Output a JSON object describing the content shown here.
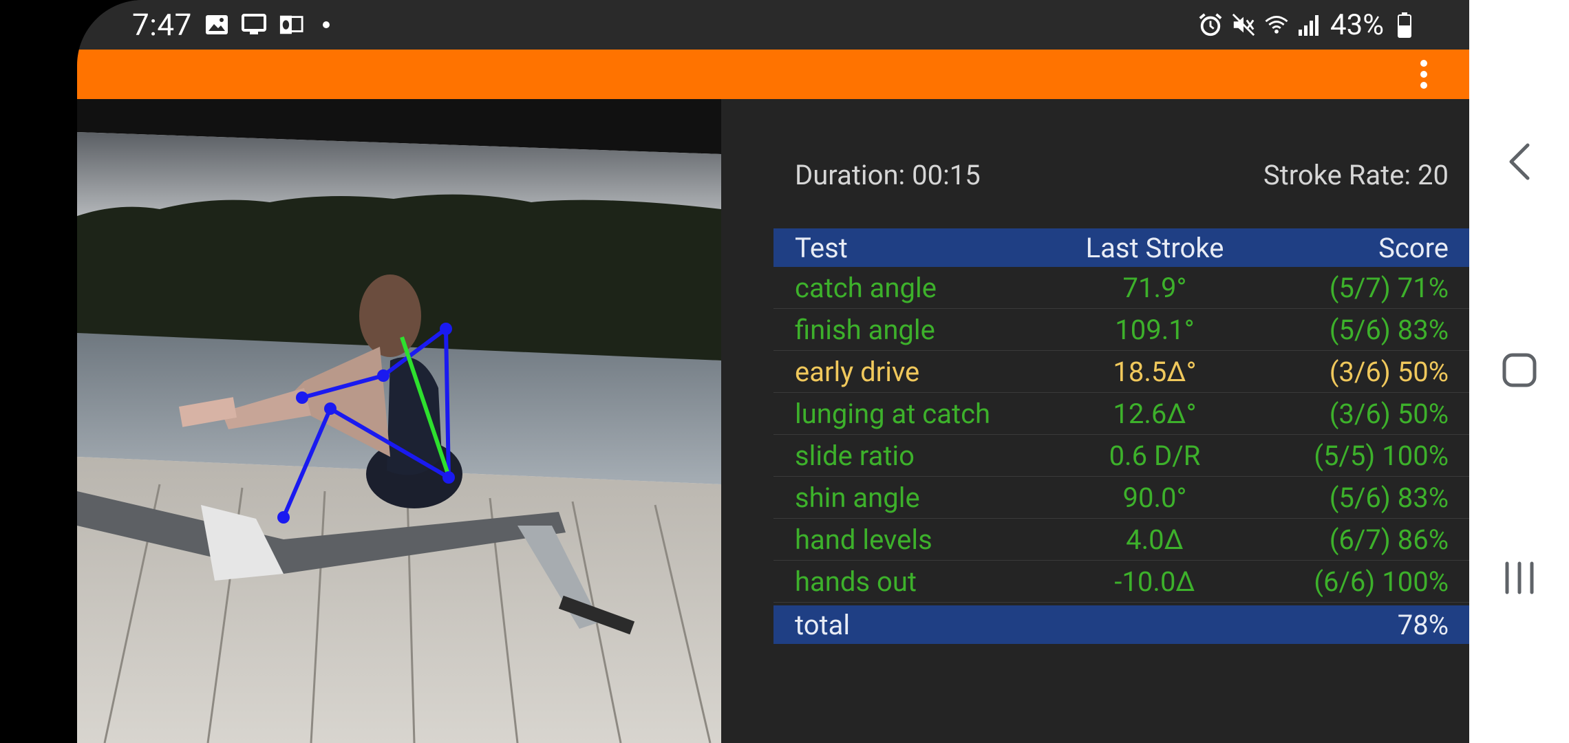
{
  "status_bar": {
    "time": "7:47",
    "battery": "43%",
    "left_icons": [
      "gallery-icon",
      "cast-icon",
      "outlook-icon",
      "notification-dot-icon"
    ],
    "right_icons": [
      "alarm-icon",
      "mute-icon",
      "wifi-icon",
      "signal-icon",
      "battery-icon"
    ]
  },
  "action_bar": {
    "color": "#ff7300",
    "menu_icon": "overflow-menu-icon"
  },
  "summary": {
    "duration": "Duration: 00:15",
    "stroke_rate": "Stroke Rate: 20"
  },
  "table": {
    "headers": [
      "Test",
      "Last Stroke",
      "Score"
    ],
    "rows": [
      {
        "test": "catch angle",
        "last": "71.9°",
        "score": "(5/7) 71%",
        "status": "green"
      },
      {
        "test": "finish angle",
        "last": "109.1°",
        "score": "(5/6) 83%",
        "status": "green"
      },
      {
        "test": "early drive",
        "last": "18.5Δ°",
        "score": "(3/6) 50%",
        "status": "yellow"
      },
      {
        "test": "lunging at catch",
        "last": "12.6Δ°",
        "score": "(3/6) 50%",
        "status": "green"
      },
      {
        "test": "slide ratio",
        "last": "0.6 D/R",
        "score": "(5/5) 100%",
        "status": "green"
      },
      {
        "test": "shin angle",
        "last": "90.0°",
        "score": "(5/6) 83%",
        "status": "green"
      },
      {
        "test": "hand levels",
        "last": "4.0Δ",
        "score": "(6/7) 86%",
        "status": "green"
      },
      {
        "test": "hands out",
        "last": "-10.0Δ",
        "score": "(6/6) 100%",
        "status": "green"
      }
    ],
    "total": {
      "label": "total",
      "score": "78%"
    }
  },
  "colors": {
    "header_bg": "#1f3f84",
    "pass": "#3db12b",
    "warn": "#f0c85c",
    "skeleton": "#1a1af0",
    "back_line": "#2ee02e"
  },
  "nav_bar": {
    "buttons": [
      "back-icon",
      "home-icon",
      "recents-icon"
    ]
  }
}
